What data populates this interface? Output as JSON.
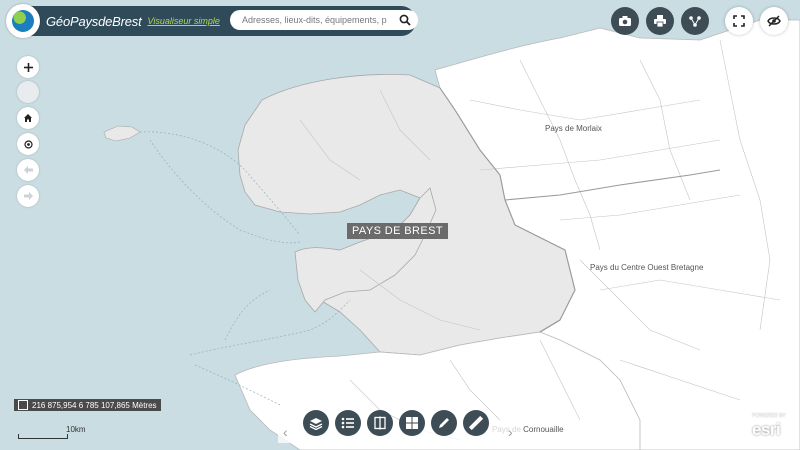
{
  "header": {
    "title": "GéoPaysdeBrest",
    "mode_link": "Visualiseur simple",
    "search_placeholder": "Adresses, lieux-dits, équipements, p"
  },
  "top_toolbar": [
    {
      "icon": "camera-icon",
      "style": "dark"
    },
    {
      "icon": "print-icon",
      "style": "dark"
    },
    {
      "icon": "share-icon",
      "style": "dark"
    },
    {
      "icon": "fullscreen-icon",
      "style": "white"
    },
    {
      "icon": "hide-icon",
      "style": "white"
    }
  ],
  "map": {
    "region_labels": {
      "morlaix": "Pays de Morlaix",
      "brest": "PAYS DE BREST",
      "centre_ouest": "Pays du Centre Ouest Bretagne",
      "cornouaille": "Pays de Cornouaille"
    },
    "colors": {
      "sea": "#c9dde3",
      "pays_de_brest": "#e9e9e9",
      "other_land": "#ffffff",
      "borders": "#a8a8a8"
    }
  },
  "coordinates": "216 875,954 6 785 107,865 Mètres",
  "scale": "10km",
  "bottom_toolbar": [
    "layers-icon",
    "legend-icon",
    "compare-icon",
    "grid-icon",
    "draw-icon",
    "measure-icon"
  ],
  "attribution": {
    "small": "POWERED BY",
    "brand": "esri"
  }
}
